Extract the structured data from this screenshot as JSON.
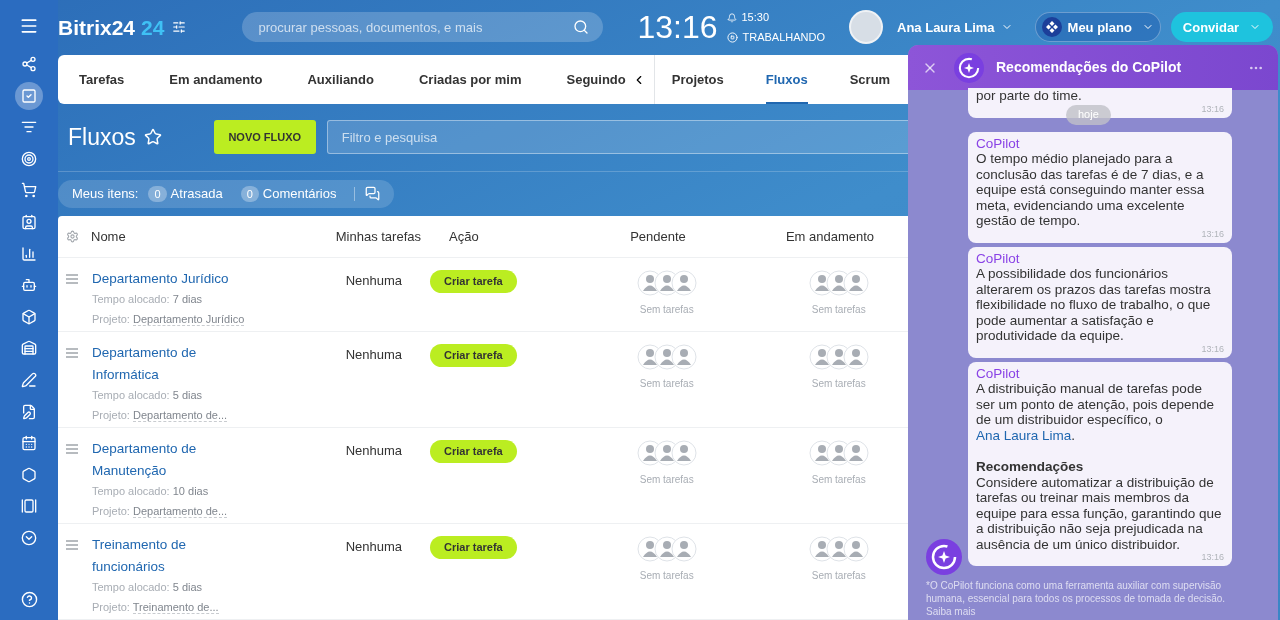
{
  "header": {
    "logo": "Bitrix24",
    "logo_number": "24",
    "search_placeholder": "procurar pessoas, documentos, e mais",
    "clock": "13:16",
    "alarm": "15:30",
    "status": "TRABALHANDO",
    "user": "Ana Laura Lima",
    "plan": "Meu plano",
    "invite": "Convidar"
  },
  "sidebar": {
    "items": [
      {
        "selected": false
      },
      {
        "selected": true
      },
      {
        "selected": false
      },
      {
        "selected": false
      },
      {
        "selected": false
      },
      {
        "selected": false
      },
      {
        "selected": false
      },
      {
        "selected": false
      },
      {
        "selected": false
      },
      {
        "selected": false
      },
      {
        "selected": false
      },
      {
        "selected": false
      },
      {
        "selected": false
      },
      {
        "selected": false
      },
      {
        "selected": false
      },
      {
        "selected": false
      }
    ]
  },
  "task_tabs": [
    {
      "label": "Tarefas",
      "selected": false
    },
    {
      "label": "Em andamento",
      "selected": false
    },
    {
      "label": "Auxiliando",
      "selected": false
    },
    {
      "label": "Criadas por mim",
      "selected": false
    },
    {
      "label": "Seguindo",
      "selected": false
    }
  ],
  "view_tabs": [
    {
      "label": "Projetos",
      "selected": false
    },
    {
      "label": "Fluxos",
      "selected": true
    },
    {
      "label": "Scrum",
      "selected": false
    }
  ],
  "page": {
    "title": "Fluxos",
    "new_button": "NOVO FLUXO",
    "filter_placeholder": "Filtro e pesquisa"
  },
  "counters": {
    "label": "Meus itens:",
    "items": [
      {
        "count": "0",
        "label": "Atrasada"
      },
      {
        "count": "0",
        "label": "Comentários"
      }
    ]
  },
  "table": {
    "columns": [
      "Nome",
      "Minhas tarefas",
      "Ação",
      "Pendente",
      "Em andamento"
    ],
    "rows": [
      {
        "name": "Departamento Jurídico",
        "time_label": "Tempo alocado:",
        "time": "7 dias",
        "project_label": "Projeto:",
        "project": "Departamento Jurídico",
        "my_tasks": "Nenhuma",
        "action": "Criar tarefa",
        "pending": "Sem tarefas",
        "in_progress": "Sem tarefas"
      },
      {
        "name": "Departamento de Informática",
        "time_label": "Tempo alocado:",
        "time": "5 dias",
        "project_label": "Projeto:",
        "project": "Departamento de...",
        "my_tasks": "Nenhuma",
        "action": "Criar tarefa",
        "pending": "Sem tarefas",
        "in_progress": "Sem tarefas"
      },
      {
        "name": "Departamento de Manutenção",
        "time_label": "Tempo alocado:",
        "time": "10 dias",
        "project_label": "Projeto:",
        "project": "Departamento de...",
        "my_tasks": "Nenhuma",
        "action": "Criar tarefa",
        "pending": "Sem tarefas",
        "in_progress": "Sem tarefas"
      },
      {
        "name": "Treinamento de funcionários",
        "time_label": "Tempo alocado:",
        "time": "5 dias",
        "project_label": "Projeto:",
        "project": "Treinamento de...",
        "my_tasks": "Nenhuma",
        "action": "Criar tarefa",
        "pending": "Sem tarefas",
        "in_progress": "Sem tarefas"
      }
    ]
  },
  "copilot": {
    "title": "Recomendações do CoPilot",
    "day": "hoje",
    "messages": [
      {
        "paragraphs": [
          {
            "kind": "text",
            "text": "por parte do time."
          }
        ],
        "time": "13:16"
      },
      {
        "sender": "CoPilot",
        "paragraphs": [
          {
            "kind": "text",
            "text": "O tempo médio planejado para a conclusão das tarefas é de 7 dias, e a equipe está conseguindo manter essa meta, evidenciando uma excelente gestão de tempo."
          }
        ],
        "time": "13:16"
      },
      {
        "sender": "CoPilot",
        "paragraphs": [
          {
            "kind": "text",
            "text": "A possibilidade dos funcionários alterarem os prazos das tarefas mostra flexibilidade no fluxo de trabalho, o que pode aumentar a satisfação e produtividade da equipe."
          }
        ],
        "time": "13:16"
      },
      {
        "sender": "CoPilot",
        "paragraphs": [
          {
            "kind": "text",
            "text": "A distribuição manual de tarefas pode ser um ponto de atenção, pois depende de um distribuidor específico, o ",
            "link": "Ana Laura Lima",
            "suffix": "."
          },
          {
            "kind": "heading",
            "text": "Recomendações"
          },
          {
            "kind": "text",
            "text": "Considere automatizar a distribuição de tarefas ou treinar mais membros da equipe para essa função, garantindo que a distribuição não seja prejudicada na ausência de um único distribuidor."
          }
        ],
        "time": "13:16"
      }
    ],
    "footer": "*O CoPilot funciona como uma ferramenta auxiliar com supervisão humana, essencial para todos os processos de tomada de decisão.",
    "footer_link": "Saiba mais"
  }
}
